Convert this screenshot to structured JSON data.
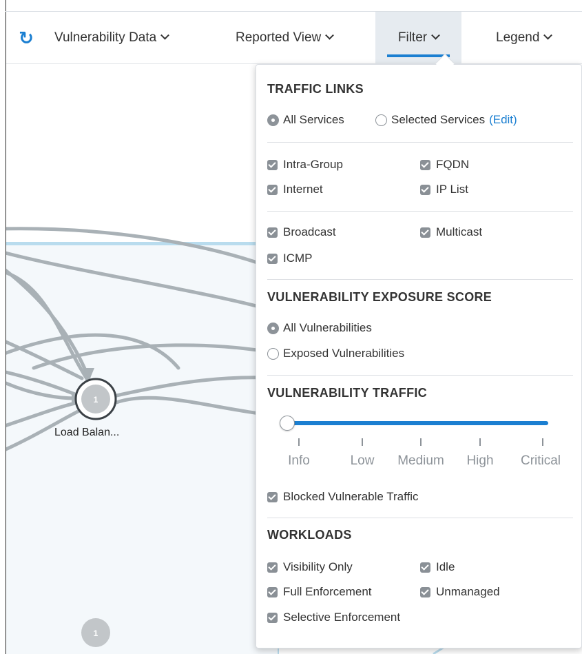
{
  "toolbar": {
    "refresh_icon": "refresh-icon",
    "vulnerability_data_label": "Vulnerability Data",
    "reported_view_label": "Reported View",
    "filter_label": "Filter",
    "legend_label": "Legend",
    "accent_color": "#1b7fd1"
  },
  "map": {
    "node_count_1": "1",
    "node_label_1": "Load Balan...",
    "node_count_2": "1"
  },
  "filter_panel": {
    "traffic_links": {
      "title": "TRAFFIC LINKS",
      "radio_all_services": "All Services",
      "radio_selected_services": "Selected Services",
      "edit_link": "(Edit)",
      "selected_radio": "All Services",
      "checks_group_1": [
        {
          "label": "Intra-Group",
          "checked": true
        },
        {
          "label": "FQDN",
          "checked": true
        },
        {
          "label": "Internet",
          "checked": true
        },
        {
          "label": "IP List",
          "checked": true
        }
      ],
      "checks_group_2": [
        {
          "label": "Broadcast",
          "checked": true
        },
        {
          "label": "Multicast",
          "checked": true
        },
        {
          "label": "ICMP",
          "checked": true
        }
      ]
    },
    "exposure_score": {
      "title": "VULNERABILITY EXPOSURE SCORE",
      "radio_all": "All Vulnerabilities",
      "radio_exposed": "Exposed Vulnerabilities",
      "selected_radio": "All Vulnerabilities"
    },
    "vulnerability_traffic": {
      "title": "VULNERABILITY TRAFFIC",
      "levels": [
        "Info",
        "Low",
        "Medium",
        "High",
        "Critical"
      ],
      "selected_level": "Info",
      "blocked_label": "Blocked Vulnerable Traffic",
      "blocked_checked": true
    },
    "workloads": {
      "title": "WORKLOADS",
      "checks": [
        {
          "label": "Visibility Only",
          "checked": true
        },
        {
          "label": "Idle",
          "checked": true
        },
        {
          "label": "Full Enforcement",
          "checked": true
        },
        {
          "label": "Unmanaged",
          "checked": true
        },
        {
          "label": "Selective Enforcement",
          "checked": true
        }
      ]
    }
  }
}
